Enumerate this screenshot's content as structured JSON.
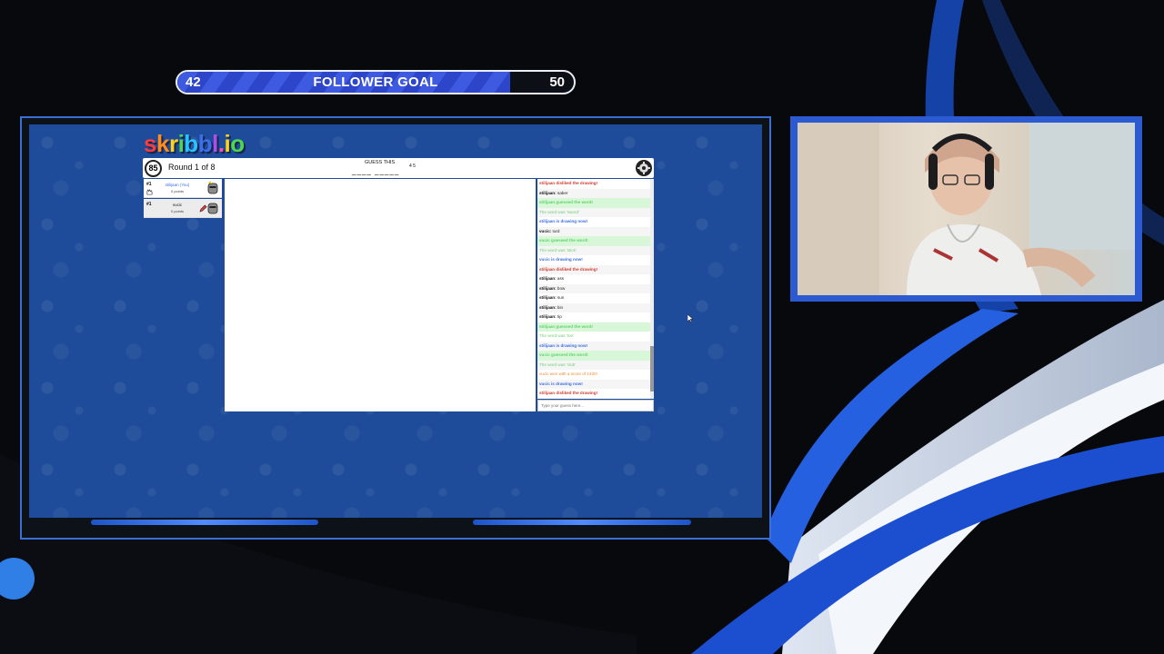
{
  "colors": {
    "accent_blue": "#2c45c9",
    "game_bg": "#1e4c9a",
    "chat_green": "#5fd36b",
    "chat_red": "#d63a2f",
    "chat_blue": "#3c6ee8",
    "chat_orange": "#f08a2e"
  },
  "follower_goal": {
    "current": "42",
    "title": "FOLLOWER GOAL",
    "target": "50",
    "progress_fraction": 0.84
  },
  "game": {
    "logo": "skribbl.io",
    "timer": "85",
    "round": "Round 1 of 8",
    "guess_label": "GUESS THIS",
    "word_hint": "____ _____",
    "word_lengths": "4 5",
    "settings_icon": "gear-icon",
    "players": [
      {
        "rank": "#1",
        "name": "stilijaan (You)",
        "points": "0 points",
        "avatar_icon": "knight-avatar-icon",
        "is_you": true
      },
      {
        "rank": "#1",
        "name": "vucic",
        "points": "0 points",
        "avatar_icon": "knight-avatar-icon",
        "is_drawing": true
      }
    ],
    "chat": [
      {
        "text": "stilijaan disliked the drawing!",
        "kind": "red"
      },
      {
        "author": "stilijaan:",
        "text": " saber",
        "kind": "normal"
      },
      {
        "text": "stilijaan guessed the word!",
        "kind": "green"
      },
      {
        "text": "The word was 'sword'",
        "kind": "green-light"
      },
      {
        "text": "stilijaan is drawing now!",
        "kind": "blue"
      },
      {
        "author": "vucic:",
        "text": " turd",
        "kind": "normal"
      },
      {
        "text": "vucic guessed the word!",
        "kind": "green"
      },
      {
        "text": "The word was 'stick'",
        "kind": "green-light"
      },
      {
        "text": "vucic is drawing now!",
        "kind": "blue"
      },
      {
        "text": "stilijaan disliked the drawing!",
        "kind": "red"
      },
      {
        "author": "stilijaan:",
        "text": " ass",
        "kind": "normal"
      },
      {
        "author": "stilijaan:",
        "text": " bow",
        "kind": "normal"
      },
      {
        "author": "stilijaan:",
        "text": " sun",
        "kind": "normal"
      },
      {
        "author": "stilijaan:",
        "text": " bin",
        "kind": "normal"
      },
      {
        "author": "stilijaan:",
        "text": " tip",
        "kind": "normal"
      },
      {
        "text": "stilijaan guessed the word!",
        "kind": "green"
      },
      {
        "text": "The word was 'toe'",
        "kind": "green-light"
      },
      {
        "text": "stilijaan is drawing now!",
        "kind": "blue"
      },
      {
        "text": "vucic guessed the word!",
        "kind": "green"
      },
      {
        "text": "The word was 'club'",
        "kind": "green-light"
      },
      {
        "text": "vucic won with a score of 1420!",
        "kind": "orange"
      },
      {
        "text": "vucic is drawing now!",
        "kind": "blue"
      },
      {
        "text": "stilijaan disliked the drawing!",
        "kind": "red"
      }
    ],
    "chat_placeholder": "Type your guess here..."
  }
}
